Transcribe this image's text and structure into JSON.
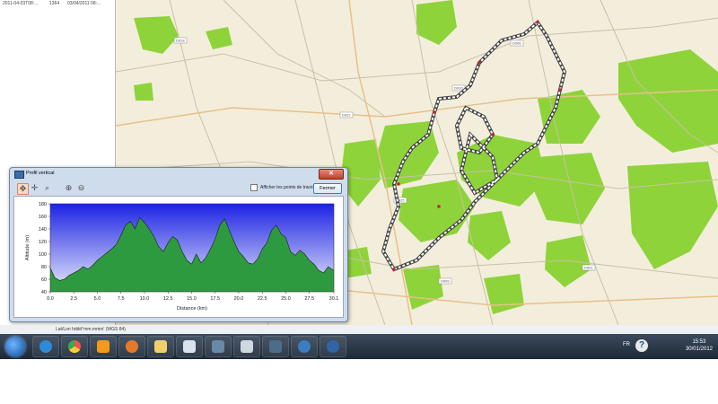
{
  "left_panel": {
    "rows": [
      {
        "name": "2011-04-03T08:...",
        "points": "1364",
        "date": "03/04/2011 08:..."
      }
    ]
  },
  "map": {
    "road_labels": [
      "D918",
      "D922",
      "D916",
      "D906",
      "D925",
      "D901",
      "D909",
      "D905"
    ],
    "colors": {
      "background": "#f3eedb",
      "forest": "#8fd33a",
      "track": "#ffffff",
      "track_outline": "#555555"
    }
  },
  "dialog": {
    "title": "Profil vertical",
    "show_points_label": "Afficher les points de tracé",
    "close_button": "Fermer",
    "close_icon": "x-icon"
  },
  "chart_data": {
    "type": "area",
    "title": "",
    "xlabel": "Distance   (km)",
    "ylabel": "Altitude (m)",
    "xlim": [
      0.0,
      30.1
    ],
    "ylim": [
      40,
      180
    ],
    "xticks": [
      "0.0",
      "2.5",
      "5.0",
      "7.5",
      "10.0",
      "12.5",
      "15.0",
      "17.5",
      "20.0",
      "22.5",
      "25.0",
      "27.5",
      "30.1"
    ],
    "yticks": [
      "40",
      "60",
      "80",
      "100",
      "120",
      "140",
      "160",
      "180"
    ],
    "grid": false,
    "fill_color": "#2e9a3f",
    "line_color": "#1b1b1b",
    "background_gradient": [
      "#1d23e4",
      "#e9ecfb"
    ],
    "x": [
      0.0,
      0.5,
      1.0,
      1.5,
      2.0,
      2.5,
      3.0,
      3.5,
      4.0,
      4.5,
      5.0,
      5.5,
      6.0,
      6.5,
      7.0,
      7.5,
      8.0,
      8.5,
      9.0,
      9.5,
      10.0,
      10.5,
      11.0,
      11.5,
      12.0,
      12.5,
      13.0,
      13.5,
      14.0,
      14.5,
      15.0,
      15.5,
      16.0,
      16.5,
      17.0,
      17.5,
      18.0,
      18.5,
      19.0,
      19.5,
      20.0,
      20.5,
      21.0,
      21.5,
      22.0,
      22.5,
      23.0,
      23.5,
      24.0,
      24.5,
      25.0,
      25.5,
      26.0,
      26.5,
      27.0,
      27.5,
      28.0,
      28.5,
      29.0,
      29.5,
      30.1
    ],
    "y": [
      78,
      62,
      58,
      60,
      66,
      70,
      74,
      80,
      76,
      82,
      90,
      96,
      102,
      108,
      115,
      130,
      146,
      152,
      140,
      158,
      150,
      140,
      128,
      112,
      104,
      118,
      128,
      122,
      104,
      90,
      84,
      100,
      86,
      94,
      108,
      124,
      146,
      156,
      138,
      120,
      104,
      96,
      86,
      84,
      92,
      108,
      118,
      138,
      146,
      132,
      126,
      104,
      98,
      106,
      100,
      90,
      84,
      74,
      70,
      80,
      74
    ]
  },
  "statusline": {
    "text": "Lat/Lon hddd°mm.mmm' (WGS 84)"
  },
  "taskbar": {
    "icons": [
      "windows-start-icon",
      "ie-icon",
      "chrome-icon",
      "media-player-icon",
      "firefox-icon",
      "folder-icon",
      "mail-icon",
      "app-icon",
      "app-icon-2",
      "app-icon-3",
      "tc-icon",
      "hp-icon"
    ],
    "lang": "FR",
    "time": "15:53",
    "date": "30/01/2012"
  }
}
